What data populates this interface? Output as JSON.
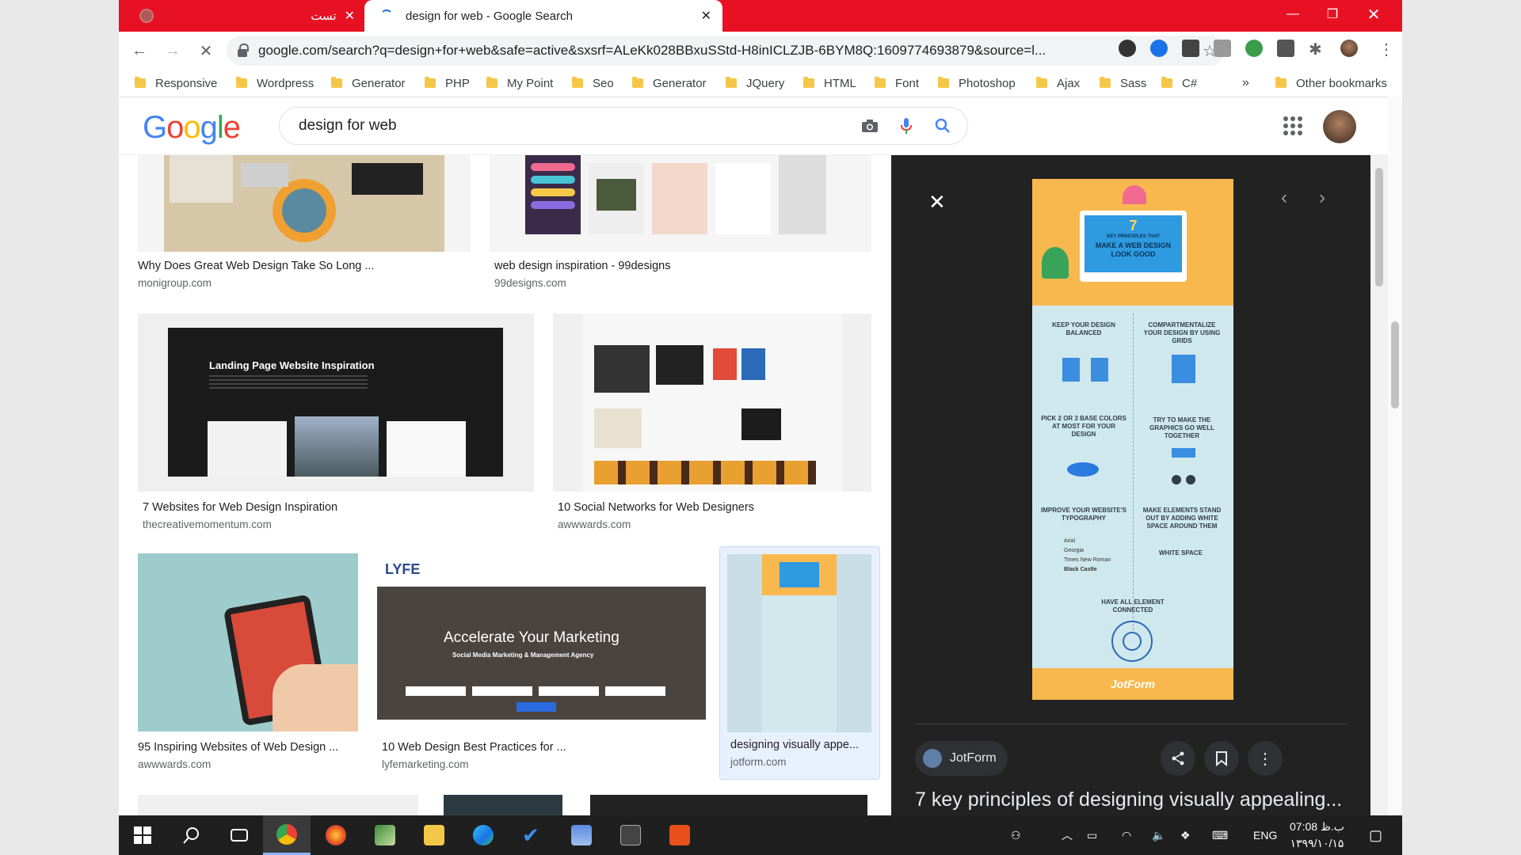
{
  "browser": {
    "tabs": [
      {
        "title": "تست",
        "active": false
      },
      {
        "title": "design for web - Google Search",
        "active": true
      }
    ],
    "url": "google.com/search?q=design+for+web&safe=active&sxsrf=ALeKk028BBxuSStd-H8inICLZJB-6BYM8Q:1609774693879&source=l...",
    "bookmarks": [
      "Responsive",
      "Wordpress",
      "Generator",
      "PHP",
      "My Point",
      "Seo",
      "Generator",
      "JQuery",
      "HTML",
      "Font",
      "Photoshop",
      "Ajax",
      "Sass",
      "C#"
    ],
    "bookmarks_more": "»",
    "other_bookmarks": "Other bookmarks"
  },
  "google": {
    "logo": [
      "G",
      "o",
      "o",
      "g",
      "l",
      "e"
    ],
    "query": "design for web"
  },
  "results": [
    {
      "title": "Why Does Great Web Design Take So Long ...",
      "source": "monigroup.com"
    },
    {
      "title": "web design inspiration - 99designs",
      "source": "99designs.com"
    },
    {
      "title": "7 Websites for Web Design Inspiration",
      "source": "thecreativemomentum.com"
    },
    {
      "title": "10 Social Networks for Web Designers",
      "source": "awwwards.com"
    },
    {
      "title": "95 Inspiring Websites of Web Design ...",
      "source": "awwwards.com"
    },
    {
      "title": "10 Web Design Best Practices for ...",
      "source": "lyfemarketing.com"
    },
    {
      "title": "designing visually appe...",
      "source": "jotform.com"
    }
  ],
  "thumbs": {
    "landing_title": "Landing Page Website Inspiration",
    "lyfe_brand": "LYFE",
    "lyfe_headline": "Accelerate Your Marketing",
    "lyfe_sub": "Social Media Marketing & Management Agency"
  },
  "preview": {
    "source": "JotForm",
    "title": "7 key principles of designing visually appealing...",
    "infographic": {
      "number": "7",
      "heading": "KEY PRINCIPLES THAT",
      "heading2": "MAKE A WEB DESIGN LOOK GOOD",
      "items": [
        "KEEP YOUR DESIGN BALANCED",
        "COMPARTMENTALIZE YOUR DESIGN BY USING GRIDS",
        "PICK 2 OR 3 BASE COLORS AT MOST FOR YOUR DESIGN",
        "TRY TO MAKE THE GRAPHICS GO WELL TOGETHER",
        "IMPROVE YOUR WEBSITE'S TYPOGRAPHY",
        "MAKE ELEMENTS STAND OUT BY ADDING WHITE SPACE AROUND THEM",
        "HAVE ALL ELEMENT CONNECTED"
      ],
      "fonts": [
        "Arial",
        "Georgia",
        "Times New Roman",
        "Black Castle"
      ],
      "whitespace": "WHITE SPACE",
      "brand": "JotForm"
    }
  },
  "taskbar": {
    "lang": "ENG",
    "time": "07:08 ب.ظ",
    "date": "۱۳۹۹/۱۰/۱۵"
  }
}
